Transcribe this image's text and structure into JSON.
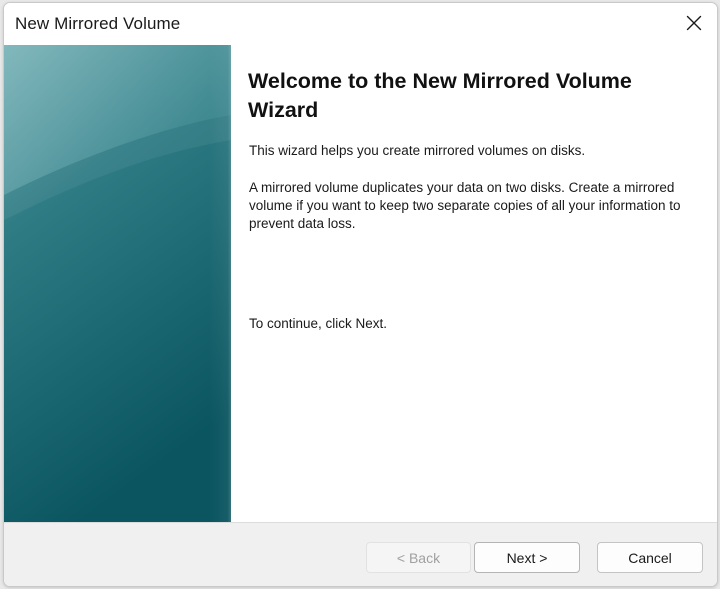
{
  "window": {
    "title": "New Mirrored Volume",
    "close_icon": "close-icon"
  },
  "colors": {
    "banner_dark": "#0e5a64",
    "banner_light": "#7fb6bb",
    "accent": "#006f7a"
  },
  "wizard": {
    "heading": "Welcome to the New Mirrored Volume Wizard",
    "intro": "This wizard helps you create mirrored volumes on disks.",
    "description": "A mirrored volume duplicates your data on two disks. Create a mirrored volume if you want to keep two separate copies of all your information to prevent  data loss.",
    "continue_text": "To continue, click Next."
  },
  "buttons": {
    "back": {
      "label": "< Back",
      "enabled": false
    },
    "next": {
      "label": "Next >",
      "enabled": true
    },
    "cancel": {
      "label": "Cancel",
      "enabled": true
    }
  }
}
